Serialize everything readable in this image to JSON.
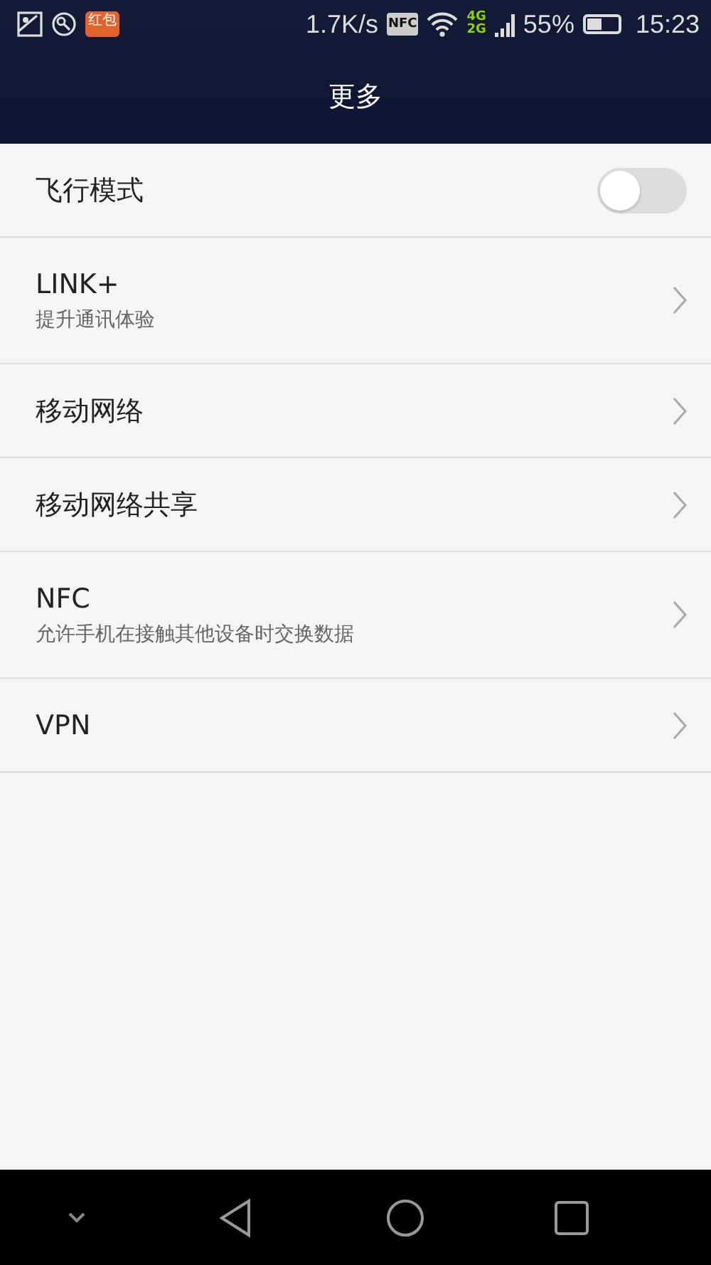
{
  "status_bar": {
    "app_badge": "红包",
    "speed": "1.7K/s",
    "nfc": "NFC",
    "net_top": "4G",
    "net_bottom": "2G",
    "battery_percent": "55%",
    "time": "15:23"
  },
  "header": {
    "title": "更多"
  },
  "items": [
    {
      "kind": "toggle",
      "title": "飞行模式",
      "on": false
    },
    {
      "kind": "link",
      "title": "LINK+",
      "subtitle": "提升通讯体验"
    },
    {
      "kind": "link",
      "title": "移动网络"
    },
    {
      "kind": "link",
      "title": "移动网络共享"
    },
    {
      "kind": "link",
      "title": "NFC",
      "subtitle": "允许手机在接触其他设备时交换数据"
    },
    {
      "kind": "link",
      "title": "VPN"
    }
  ]
}
